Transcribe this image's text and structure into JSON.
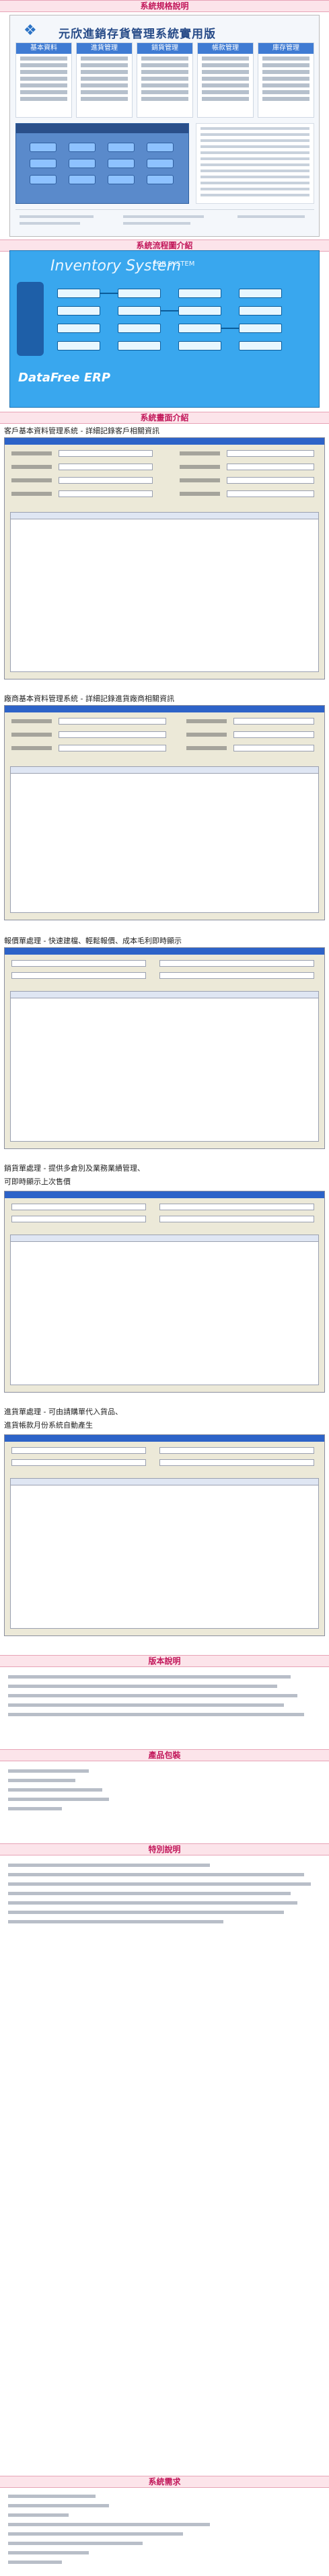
{
  "sections": {
    "spec": "系統規格說明",
    "flow": "系統流程圖介紹",
    "screens": "系統畫面介紹",
    "version": "版本說明",
    "contents": "產品包裝",
    "notice": "特別說明",
    "sysreq": "系統需求"
  },
  "product": {
    "title": "元欣進銷存貨管理系統實用版",
    "modules": [
      "基本資料",
      "進貨管理",
      "銷貨管理",
      "帳款管理",
      "庫存管理"
    ]
  },
  "flow": {
    "title": "Inventory System",
    "subtitle": "ERP SYSTEM",
    "brand": "DataFree ERP"
  },
  "screens": [
    {
      "caption": "客戶基本資料管理系統 - 詳細記錄客戶相關資訊"
    },
    {
      "caption": "廠商基本資料管理系統 - 詳細記錄進貨廠商相關資訊"
    },
    {
      "caption": "報價單處理 - 快速建檔、輕鬆報價、成本毛利即時顯示"
    },
    {
      "caption": "銷貨單處理 - 提供多倉別及業務業績管理、",
      "caption2": "可即時顯示上次售價"
    },
    {
      "caption": "進貨單處理 - 可由請購單代入貨品、",
      "caption2": "進貨帳款月份系統自動產生"
    }
  ],
  "version_items": [
    "",
    "",
    "",
    "",
    ""
  ],
  "content_items": [
    "",
    "",
    "",
    "",
    ""
  ],
  "notice_items": [
    "",
    "",
    "",
    "",
    "",
    "",
    ""
  ],
  "sysreq_items": [
    "",
    "",
    "",
    "",
    "",
    "",
    "",
    ""
  ]
}
